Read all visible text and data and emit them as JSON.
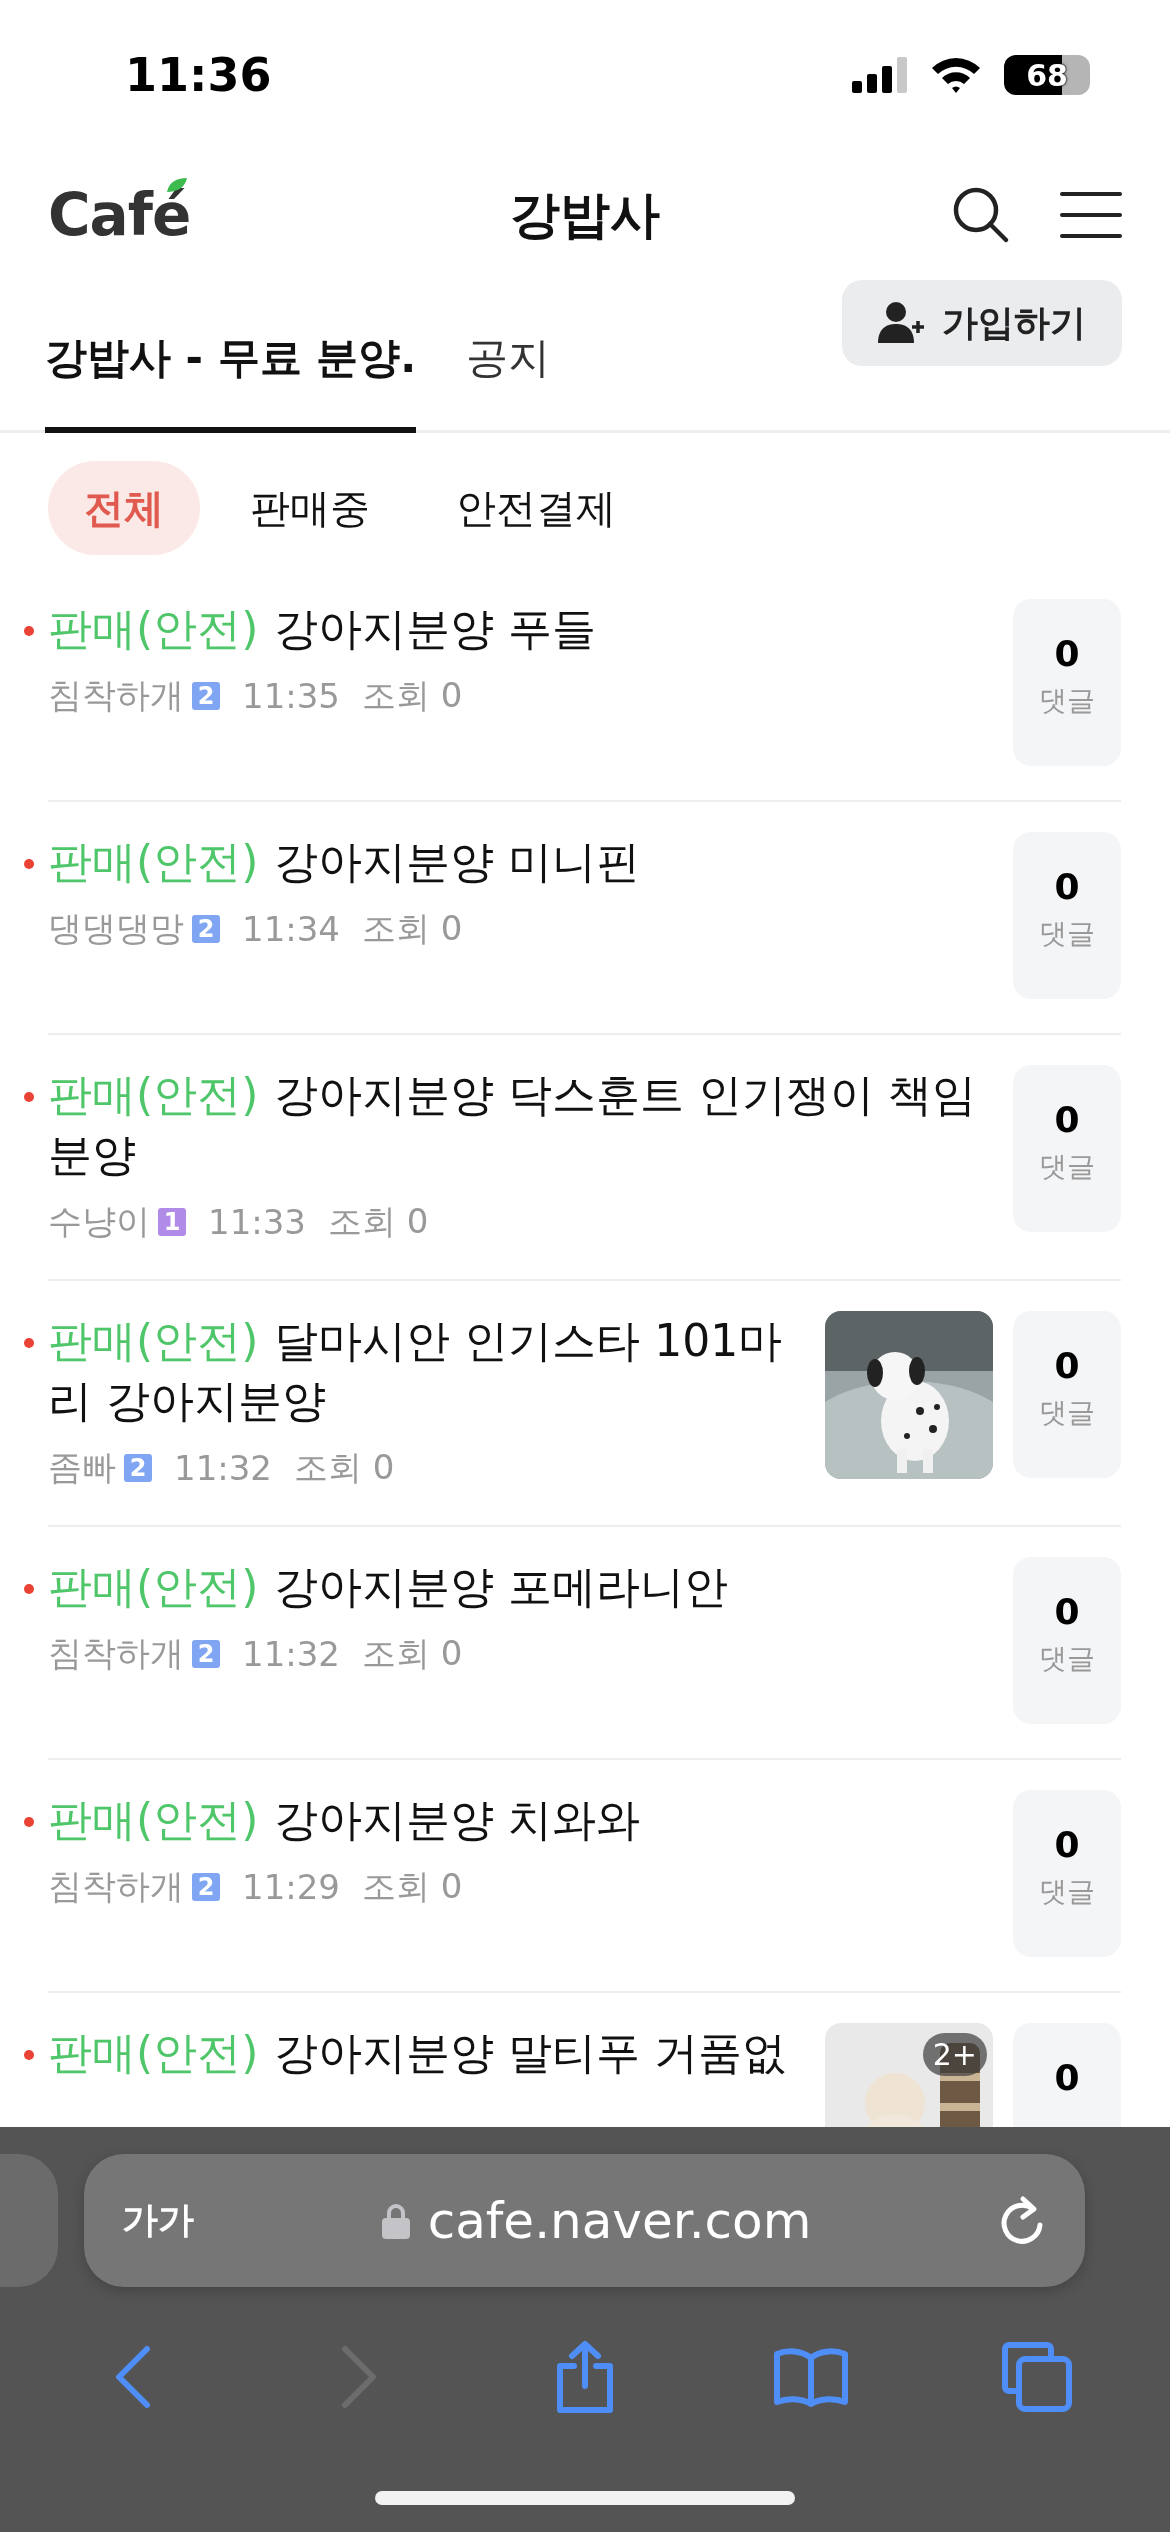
{
  "status_bar": {
    "time": "11:36",
    "battery": "68"
  },
  "header": {
    "logo": "Café",
    "title": "강밥사"
  },
  "tabs": [
    {
      "label": "강밥사 - 무료 분양.",
      "selected": true
    },
    {
      "label": "공지",
      "selected": false
    }
  ],
  "join_button": {
    "label": "가입하기"
  },
  "filters": [
    {
      "label": "전체",
      "selected": true
    },
    {
      "label": "판매중",
      "selected": false
    },
    {
      "label": "안전결제",
      "selected": false
    }
  ],
  "posts": [
    {
      "new": true,
      "tag": "판매(안전)",
      "title": "강아지분양 푸들",
      "author": "침착하개",
      "level": "2",
      "color": "#7fa5f3",
      "time": "11:35",
      "views": "조회 0",
      "comments": "0",
      "comments_label": "댓글"
    },
    {
      "new": true,
      "tag": "판매(안전)",
      "title": "강아지분양 미니핀",
      "author": "댕댕댕망",
      "level": "2",
      "color": "#7fa5f3",
      "time": "11:34",
      "views": "조회 0",
      "comments": "0",
      "comments_label": "댓글"
    },
    {
      "new": true,
      "tag": "판매(안전)",
      "title": "강아지분양 닥스훈트 인기쟁이 책임분양",
      "author": "수냥이",
      "level": "1",
      "color": "#b18be8",
      "time": "11:33",
      "views": "조회 0",
      "comments": "0",
      "comments_label": "댓글"
    },
    {
      "new": true,
      "tag": "판매(안전)",
      "title": "달마시안 인기스타 101마리 강아지분양",
      "author": "좀빠",
      "level": "2",
      "color": "#7fa5f3",
      "time": "11:32",
      "views": "조회 0",
      "comments": "0",
      "comments_label": "댓글"
    },
    {
      "new": true,
      "tag": "판매(안전)",
      "title": "강아지분양 포메라니안",
      "author": "침착하개",
      "level": "2",
      "color": "#7fa5f3",
      "time": "11:32",
      "views": "조회 0",
      "comments": "0",
      "comments_label": "댓글"
    },
    {
      "new": true,
      "tag": "판매(안전)",
      "title": "강아지분양 치와와",
      "author": "침착하개",
      "level": "2",
      "color": "#7fa5f3",
      "time": "11:29",
      "views": "조회 0",
      "comments": "0",
      "comments_label": "댓글"
    },
    {
      "new": true,
      "tag": "판매(안전)",
      "title": "강아지분양 말티푸 거품없",
      "comments": "0",
      "thumbnail": {
        "kind": "picture",
        "count": "2+"
      }
    }
  ],
  "browser": {
    "text_size": "가가",
    "url": "cafe.naver.com",
    "toolbar": [
      {
        "kind": "back",
        "disabled": false
      },
      {
        "kind": "forward",
        "disabled": true
      },
      {
        "kind": "share",
        "disabled": false
      },
      {
        "kind": "bookmarks",
        "disabled": false
      },
      {
        "kind": "tabs",
        "disabled": false
      }
    ]
  }
}
